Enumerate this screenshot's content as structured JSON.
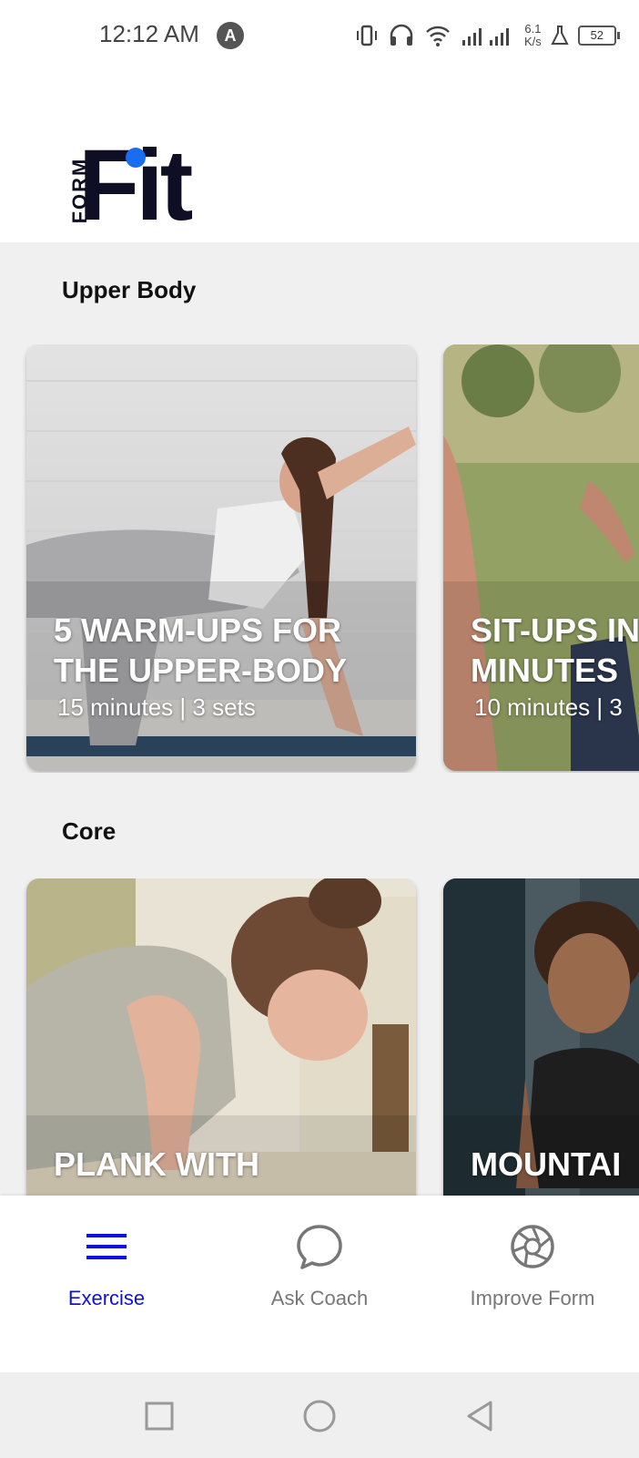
{
  "status_bar": {
    "time": "12:12 AM",
    "notif_icon": "A",
    "net_speed_value": "6.1",
    "net_speed_unit": "K/s",
    "battery": "52"
  },
  "brand": {
    "word1": "FORM",
    "word2": "Fit",
    "dot_color": "#1a6cf0",
    "ink_color": "#0e0f24"
  },
  "sections": [
    {
      "title": "Upper Body",
      "cards": [
        {
          "title_line1": "5 WARM-UPS FOR",
          "title_line2": "THE UPPER-BODY",
          "meta": "15 minutes | 3 sets"
        },
        {
          "title_line1": "SIT-UPS IN",
          "title_line2": "MINUTES",
          "meta": "10 minutes | 3"
        }
      ]
    },
    {
      "title": "Core",
      "cards": [
        {
          "title_line1": "PLANK WITH"
        },
        {
          "title_line1": "MOUNTAI"
        }
      ]
    }
  ],
  "bottom_nav": [
    {
      "label": "Exercise",
      "icon": "menu-icon",
      "active": true
    },
    {
      "label": "Ask Coach",
      "icon": "chat-bubble-icon",
      "active": false
    },
    {
      "label": "Improve Form",
      "icon": "camera-aperture-icon",
      "active": false
    }
  ],
  "colors": {
    "active": "#1010dd",
    "inactive": "#777777",
    "background": "#f0f0f0"
  }
}
